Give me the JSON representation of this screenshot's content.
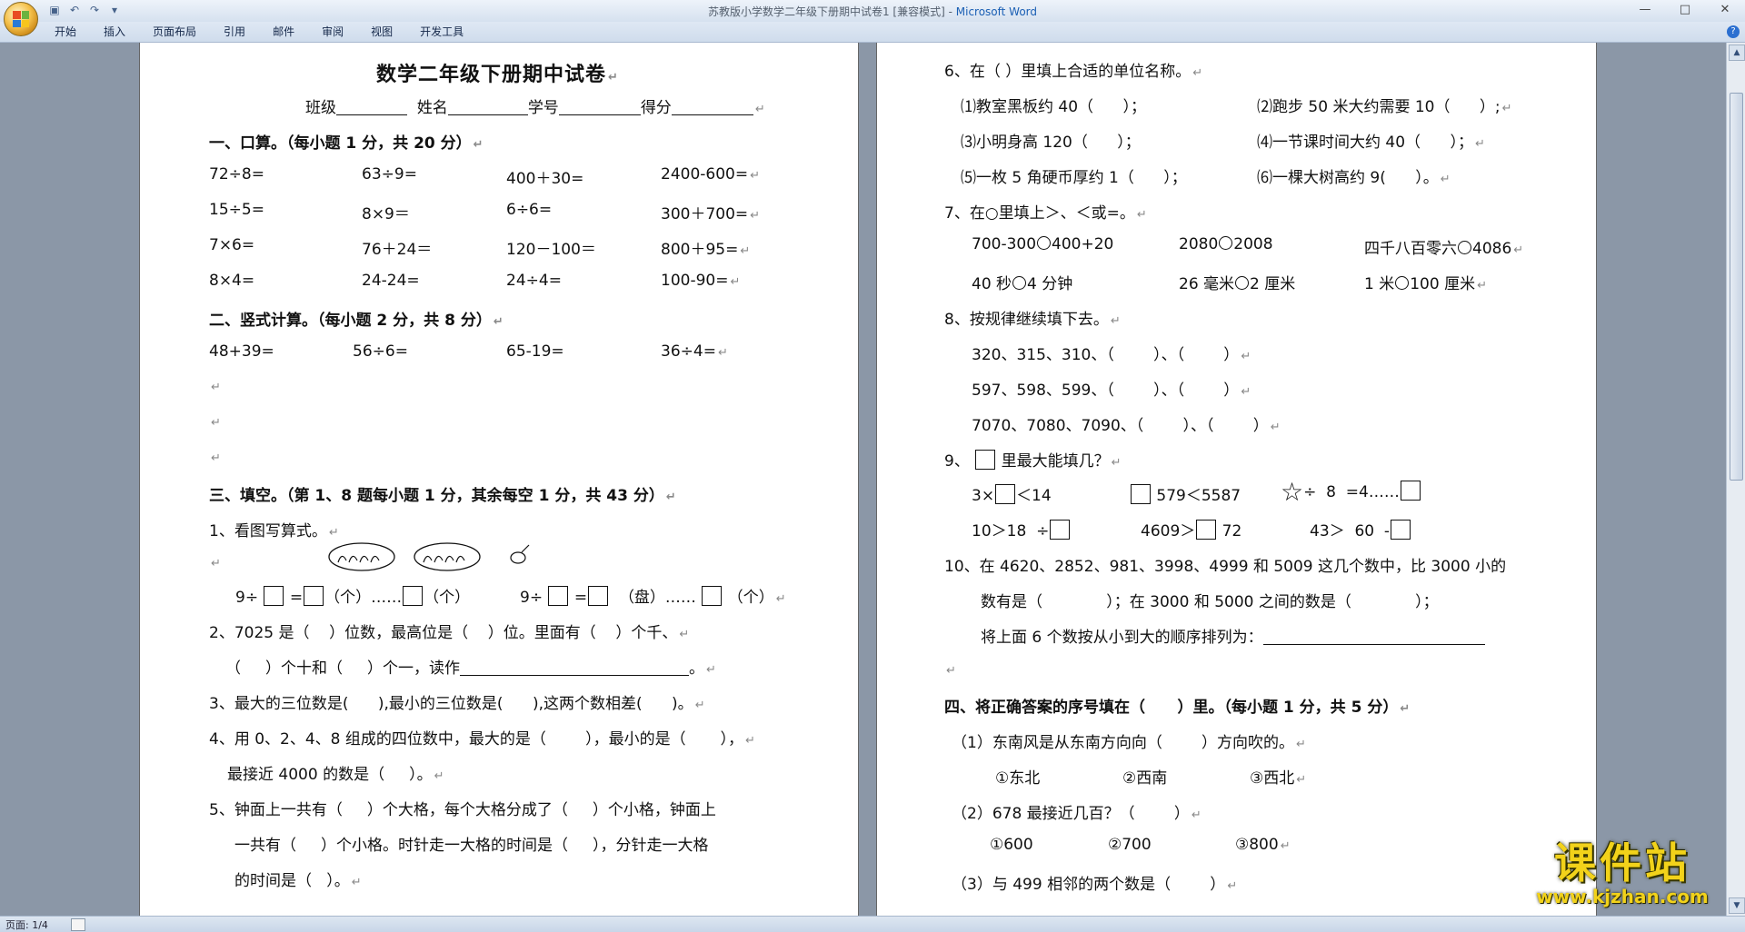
{
  "window": {
    "title_doc": "苏教版小学数学二年级下册期中试卷1 [兼容模式] - ",
    "title_app": "Microsoft Word"
  },
  "ribbon_tabs": [
    "开始",
    "插入",
    "页面布局",
    "引用",
    "邮件",
    "审阅",
    "视图",
    "开发工具"
  ],
  "status": {
    "page": "页面: 1/4"
  },
  "watermark": {
    "big": "课件站",
    "small": "www.kjzhan.com"
  },
  "page1": {
    "title": "数学二年级下册期中试卷",
    "info": {
      "class": "班级",
      "name": "姓名",
      "number": "学号",
      "score": "得分"
    },
    "s1": "一、口算。（每小题 1 分，共 20 分）",
    "mental": [
      [
        "72÷8=",
        "63÷9=",
        "400＋30=",
        "2400-600="
      ],
      [
        "15÷5=",
        "8×9＝",
        "6÷6=",
        "300＋700="
      ],
      [
        "7×6=",
        "76＋24＝",
        "120－100＝",
        "800＋95="
      ],
      [
        "8×4=",
        "24-24=",
        "24÷4=",
        "100-90="
      ]
    ],
    "s2": "二、竖式计算。（每小题 2 分，共 8 分）",
    "vertical": [
      "48+39=",
      "56÷6=",
      "65-19=",
      "36÷4="
    ],
    "s3": "三、填空。（第 1、8 题每小题 1 分，其余每空 1 分，共 43 分）",
    "q1": "1、看图写算式。",
    "q1_a": "9÷",
    "q1_b": "=",
    "q1_c": "（个）……",
    "q1_d": "（个）",
    "q1_e": "9÷",
    "q1_f": "=",
    "q1_g": "（盘）……",
    "q1_h": "（个）",
    "q2_l1": "2、7025 是（    ）位数，最高位是（    ）位。里面有（    ）个千、",
    "q2_l2a": "（     ）个十和（     ）个一，读作",
    "q2_l2b": "。",
    "q3": "3、最大的三位数是(      ),最小的三位数是(      ),这两个数相差(      )。",
    "q4_l1": "4、用 0、2、4、8 组成的四位数中，最大的是（        ），最小的是（       ），",
    "q4_l2": "最接近 4000 的数是（     ）。",
    "q5_l1": "5、钟面上一共有（     ）个大格，每个大格分成了（     ）个小格，钟面上",
    "q5_l2": "一共有（     ）个小格。时针走一大格的时间是（     ），分针走一大格",
    "q5_l3": "的时间是（   ）。"
  },
  "page2": {
    "q6": "6、在（ ）里填上合适的单位名称。",
    "q6_items": [
      [
        "⑴教室黑板约 40（      ）；",
        "⑵跑步 50 米大约需要 10（      ）;"
      ],
      [
        "⑶小明身高 120（      ）；",
        "⑷一节课时间大约 40（      ）；"
      ],
      [
        "⑸一枚 5 角硬币厚约 1（      ）；",
        "⑹一棵大树高约 9(      ）。"
      ]
    ],
    "q7": "7、在○里填上＞、＜或=。",
    "q7_items": [
      [
        "700-300",
        "400+20",
        "2080",
        "2008",
        "四千八百零六",
        "4086"
      ],
      [
        "40 秒",
        "4 分钟",
        "26 毫米",
        "2 厘米",
        "1 米",
        "100 厘米"
      ]
    ],
    "q8": "8、按规律继续填下去。",
    "q8_items": [
      "320、315、310、（        ）、（        ）",
      "597、598、599、（        ）、（        ）",
      "7070、7080、7090、（        ）、（        ）"
    ],
    "q9": "里最大能填几？",
    "q9_prefix": "9、",
    "q9_r1": [
      "3×",
      "＜14",
      "579＜5587",
      "÷  8  =4……"
    ],
    "q9_r2": [
      "10＞18  ÷",
      "4609＞",
      "72",
      "43＞  60  -"
    ],
    "q10_l1": "10、在 4620、2852、981、3998、4999 和 5009 这几个数中，比 3000 小的",
    "q10_l2": "数有是（             ）；在 3000 和 5000 之间的数是（             ）；",
    "q10_l3": "将上面 6 个数按从小到大的顺序排列为：",
    "s4": "四、将正确答案的序号填在（      ）里。（每小题 1 分，共 5 分）",
    "c1": "（1）东南风是从东南方向向（        ）方向吹的。",
    "c1_opts": [
      "①东北",
      "②西南",
      "③西北"
    ],
    "c2": "（2）678 最接近几百？（        ）",
    "c2_opts": [
      "①600",
      "②700",
      "③800"
    ],
    "c3": "（3）与 499 相邻的两个数是（        ）"
  }
}
